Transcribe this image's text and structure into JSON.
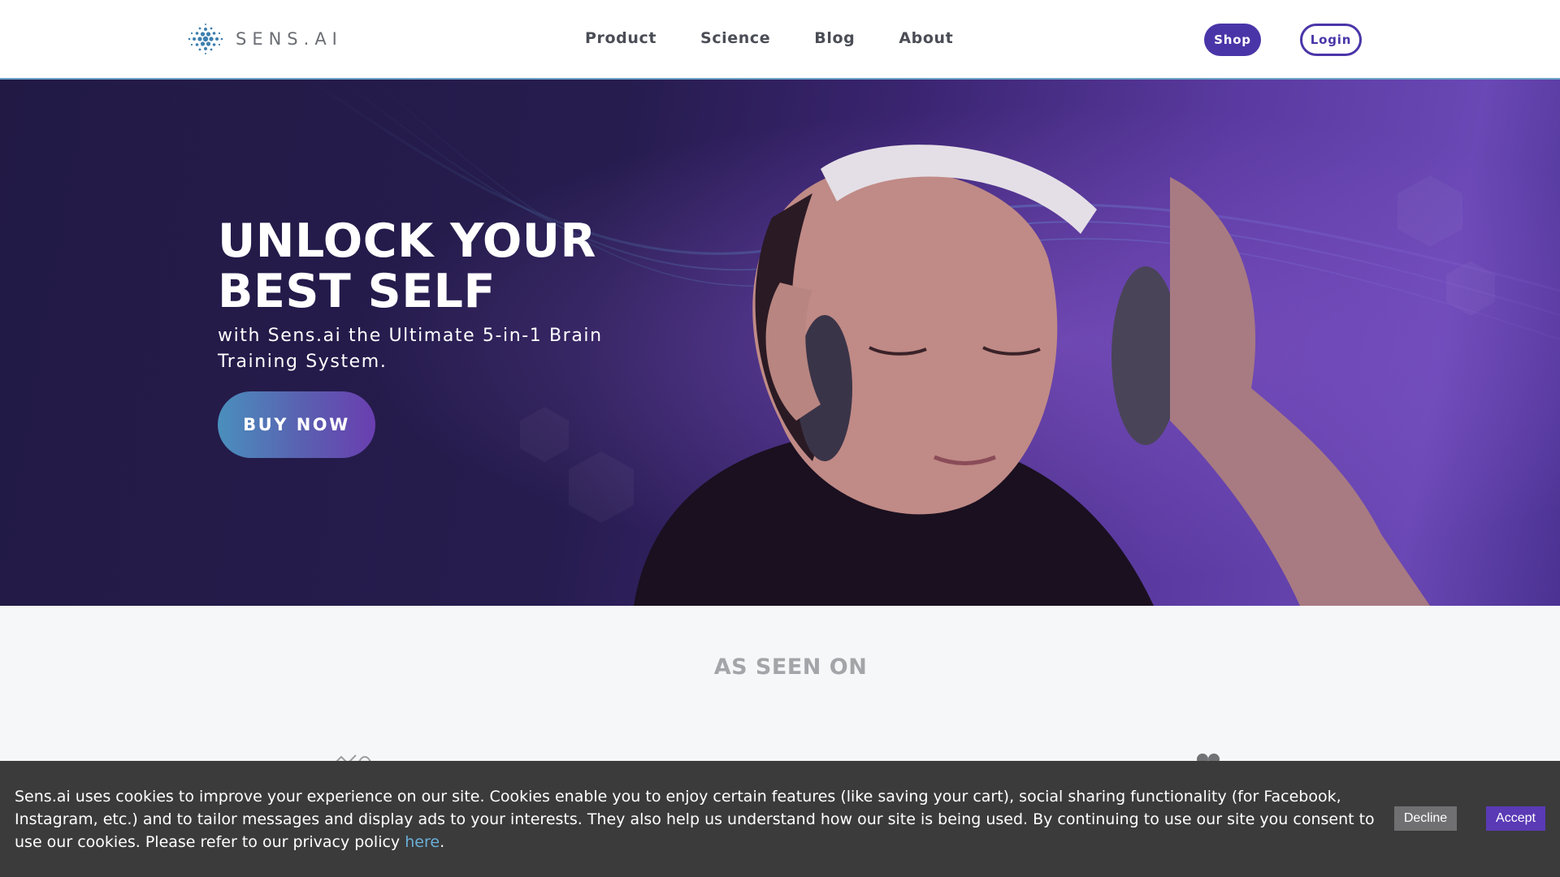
{
  "header": {
    "logo_text": "SENS.AI",
    "nav": [
      {
        "label": "Product"
      },
      {
        "label": "Science"
      },
      {
        "label": "Blog"
      },
      {
        "label": "About"
      }
    ],
    "shop_label": "Shop",
    "login_label": "Login"
  },
  "hero": {
    "title_line1": "UNLOCK YOUR",
    "title_line2": "BEST SELF",
    "subtitle": "with Sens.ai the Ultimate 5-in-1 Brain Training System.",
    "cta_label": "BUY NOW",
    "image": "woman-wearing-headset"
  },
  "press": {
    "title": "AS SEEN ON"
  },
  "cookie_banner": {
    "text": "Sens.ai uses cookies to improve your experience on our site. Cookies enable you to enjoy certain features (like saving your cart), social sharing functionality (for Facebook, Instagram, etc.) and to tailor messages and display ads to your interests. They also help us understand how our site is being used. By continuing to use our site you consent to use our cookies. Please refer to our privacy policy",
    "link_label": "here",
    "link_suffix": ".",
    "decline_label": "Decline",
    "accept_label": "Accept"
  },
  "colors": {
    "accent": "#4a35a8",
    "hero_bg": "#241b4a",
    "cookie_bg": "#3b3b3c",
    "link": "#6ab0d8"
  }
}
